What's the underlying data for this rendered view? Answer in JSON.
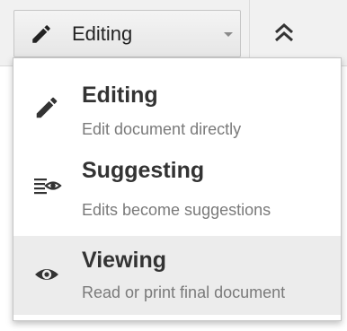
{
  "toolbar": {
    "mode_button": {
      "label": "Editing",
      "icon": "pencil-icon"
    },
    "collapse_button": {
      "icon": "double-chevron-up-icon"
    }
  },
  "mode_menu": {
    "items": [
      {
        "title": "Editing",
        "description": "Edit document directly",
        "icon": "pencil-icon",
        "selected": false
      },
      {
        "title": "Suggesting",
        "description": "Edits become suggestions",
        "icon": "suggest-edit-icon",
        "selected": false
      },
      {
        "title": "Viewing",
        "description": "Read or print final document",
        "icon": "eye-icon",
        "selected": true
      }
    ]
  },
  "colors": {
    "toolbar_bg": "#f1f1f1",
    "selected_item_bg": "#ececec",
    "title_text": "#333333",
    "description_text": "#7a7a7a",
    "icon": "#333333"
  }
}
